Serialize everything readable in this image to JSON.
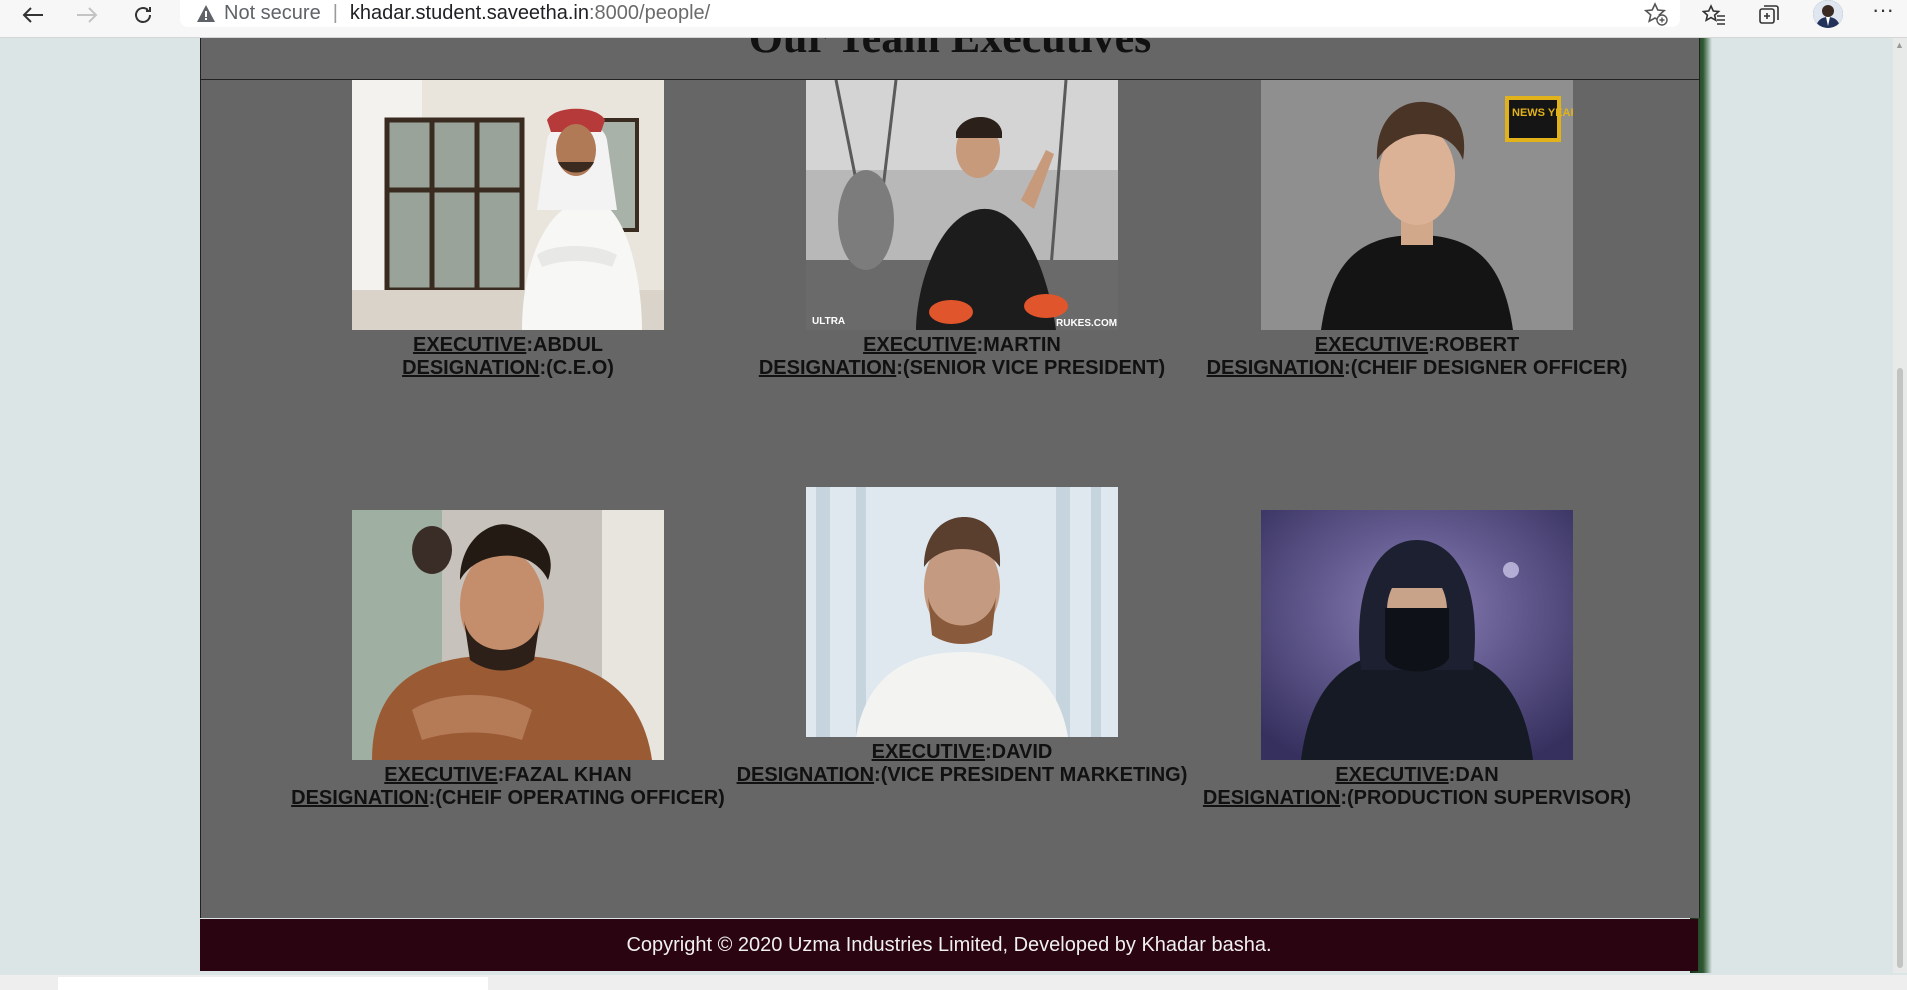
{
  "browser": {
    "security_label": "Not secure",
    "separator": "|",
    "url_host": "khadar.student.saveetha.in",
    "url_rest": ":8000/people/"
  },
  "page": {
    "heading": "Our Team Executives",
    "executives": [
      {
        "key_executive": "EXECUTIVE",
        "name": ":ABDUL",
        "key_designation": "DESIGNATION",
        "designation": ":(C.E.O)",
        "photo": "man-in-white-thobe-photo"
      },
      {
        "key_executive": "EXECUTIVE",
        "name": ":MARTIN",
        "key_designation": "DESIGNATION",
        "designation": ":(SENIOR VICE PRESIDENT)",
        "photo": "man-on-stage-photo",
        "watermark_left": "ULTRA",
        "watermark_right": "RUKES.COM"
      },
      {
        "key_executive": "EXECUTIVE",
        "name": ":ROBERT",
        "key_designation": "DESIGNATION",
        "designation": ":(CHEIF DESIGNER OFFICER)",
        "photo": "man-black-tshirt-photo",
        "badge": "NEWS YEAR"
      },
      {
        "key_executive": "EXECUTIVE",
        "name": ":FAZAL KHAN",
        "key_designation": "DESIGNATION",
        "designation": ":(CHEIF OPERATING OFFICER)",
        "photo": "bearded-man-brown-shirt-photo"
      },
      {
        "key_executive": "EXECUTIVE",
        "name": ":DAVID",
        "key_designation": "DESIGNATION",
        "designation": ":(VICE PRESIDENT MARKETING)",
        "photo": "man-white-tshirt-photo"
      },
      {
        "key_executive": "EXECUTIVE",
        "name": ":DAN",
        "key_designation": "DESIGNATION",
        "designation": ":(PRODUCTION SUPERVISOR)",
        "photo": "masked-man-hoodie-photo"
      }
    ],
    "footer": "Copyright © 2020 Uzma Industries Limited, Developed by Khadar basha."
  }
}
